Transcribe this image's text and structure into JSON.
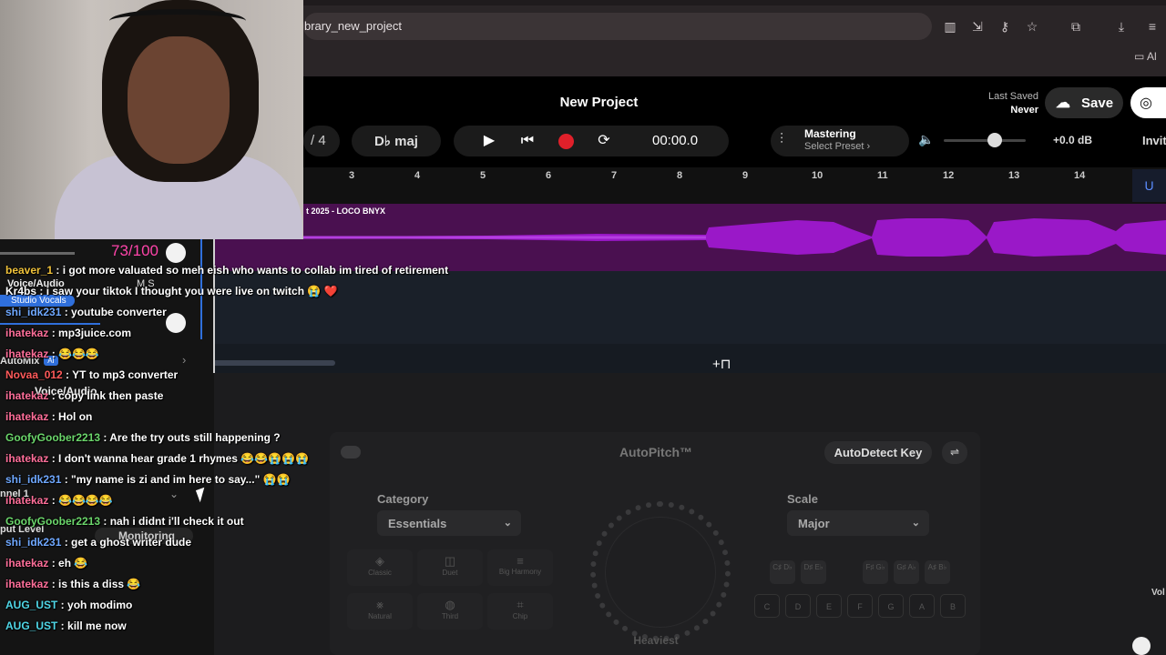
{
  "browser": {
    "url": "brary_new_project",
    "bookmark_folder": "Al"
  },
  "header": {
    "project_title": "New Project",
    "last_saved_label": "Last Saved",
    "last_saved_value": "Never",
    "save_label": "Save",
    "invite_label": "Invit"
  },
  "toolbar": {
    "time_signature": "/ 4",
    "key": "D♭ maj",
    "time": "00:00.0",
    "mastering_title": "Mastering",
    "mastering_preset": "Select Preset ›",
    "volume_db": "+0.0 dB",
    "volume_level": 0.62
  },
  "ruler": {
    "bars": [
      "3",
      "4",
      "5",
      "6",
      "7",
      "8",
      "9",
      "10",
      "11",
      "12",
      "13",
      "14"
    ],
    "marker": "U"
  },
  "track": {
    "clip_label": "t 2025 - LOCO BNYX"
  },
  "autopitch": {
    "title": "AutoPitch™",
    "autodetect_label": "AutoDetect Key",
    "category_label": "Category",
    "category_value": "Essentials",
    "scale_label": "Scale",
    "scale_value": "Major",
    "styles_row1": [
      "Classic",
      "Duet",
      "Big Harmony"
    ],
    "styles_row2": [
      "Natural",
      "Third",
      "Chip"
    ],
    "knob_label": "Heaviest",
    "notes_top": [
      "C♯ D♭",
      "D♯ E♭",
      "F♯ G♭",
      "G♯ A♭",
      "A♯ B♭"
    ],
    "notes_bottom": [
      "C",
      "D",
      "E",
      "F",
      "G",
      "A",
      "B"
    ],
    "edge_label": "Vol"
  },
  "sidebar": {
    "volume_readout": "73/100",
    "track_name": "Voice/Audio",
    "ms": "M  S",
    "preset": "Studio Vocals",
    "automix": "AutoMix",
    "ai_badge": "AI",
    "second_track": "Voice/Audio",
    "channel": "nnel 1",
    "input_level": "put Level",
    "monitoring": "Monitoring"
  },
  "chat": [
    {
      "user": "beaver_1",
      "color": "#f0c23a",
      "text": "i got more valuated so meh eish who wants to collab im tired of retirement"
    },
    {
      "user": "Kr4bs",
      "color": "#ffffff",
      "text": "i saw your tiktok I thought you were live on twitch 😭 ❤️"
    },
    {
      "user": "shi_idk231",
      "color": "#6fa8ff",
      "text": "youtube converter"
    },
    {
      "user": "ihatekaz",
      "color": "#ff6f9a",
      "text": "mp3juice.com"
    },
    {
      "user": "ihatekaz",
      "color": "#ff6f9a",
      "text": "😂😂😂"
    },
    {
      "user": "Novaa_012",
      "color": "#ff5a5a",
      "text": "YT to mp3 converter"
    },
    {
      "user": "ihatekaz",
      "color": "#ff6f9a",
      "text": "copy link then paste"
    },
    {
      "user": "ihatekaz",
      "color": "#ff6f9a",
      "text": "Hol on"
    },
    {
      "user": "GoofyGoober2213",
      "color": "#6bd66b",
      "text": "Are the try outs still happening ?"
    },
    {
      "user": "ihatekaz",
      "color": "#ff6f9a",
      "text": "I don't wanna hear grade 1 rhymes 😂😂😭😭😭"
    },
    {
      "user": "shi_idk231",
      "color": "#6fa8ff",
      "text": "\"my name is zi and im here to say...\" 😭😭"
    },
    {
      "user": "ihatekaz",
      "color": "#ff6f9a",
      "text": "😂😂😂😂"
    },
    {
      "user": "GoofyGoober2213",
      "color": "#6bd66b",
      "text": "nah i didnt i'll check it out"
    },
    {
      "user": "shi_idk231",
      "color": "#6fa8ff",
      "text": "get a ghost writer dude"
    },
    {
      "user": "ihatekaz",
      "color": "#ff6f9a",
      "text": "eh 😂"
    },
    {
      "user": "ihatekaz",
      "color": "#ff6f9a",
      "text": "is this a diss 😂"
    },
    {
      "user": "AUG_UST",
      "color": "#4fd6e6",
      "text": "yoh modimo"
    },
    {
      "user": "AUG_UST",
      "color": "#4fd6e6",
      "text": "kill me now"
    }
  ]
}
